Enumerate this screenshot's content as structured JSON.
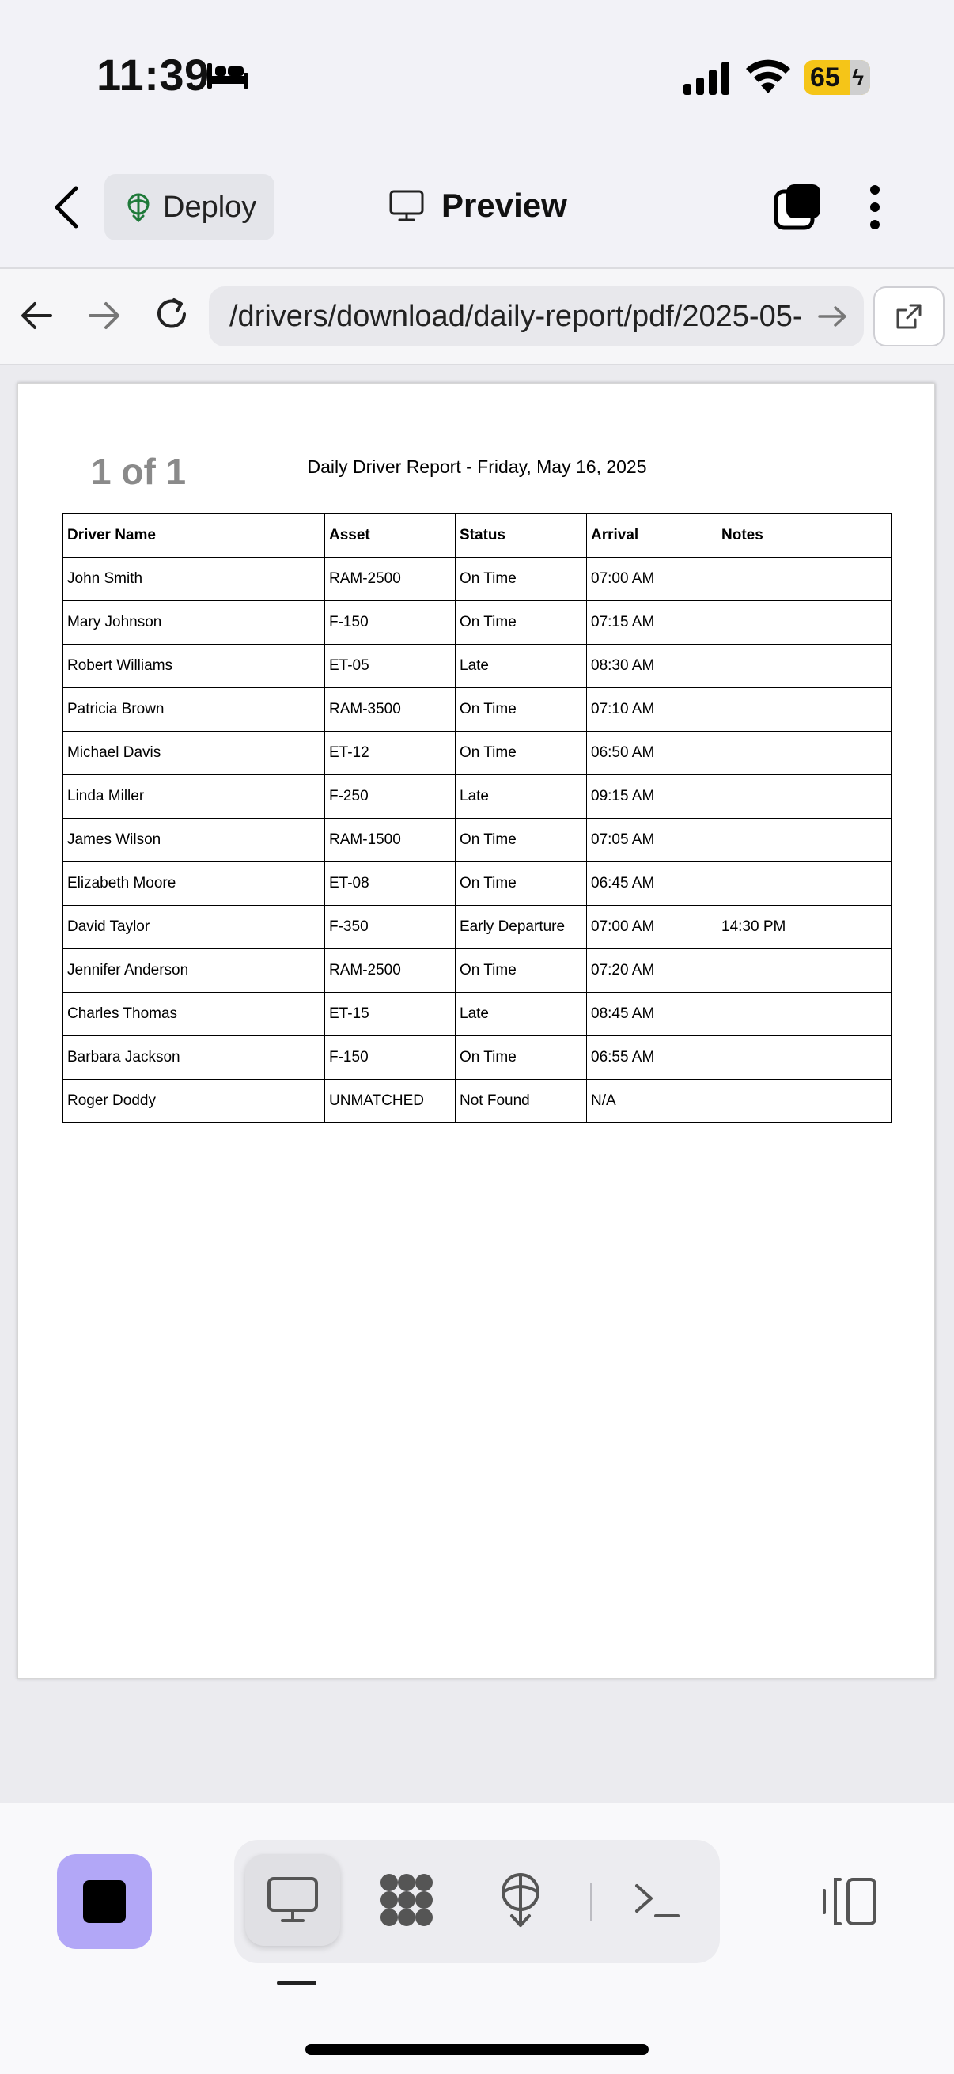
{
  "status_bar": {
    "time": "11:39",
    "battery": "65",
    "icons": [
      "bed-icon",
      "signal-icon",
      "wifi-icon",
      "battery-charging-icon"
    ]
  },
  "header": {
    "deploy_label": "Deploy",
    "title": "Preview"
  },
  "browser": {
    "url": "/drivers/download/daily-report/pdf/2025-05-"
  },
  "pdf": {
    "page_indicator": "1 of 1",
    "report_title": "Daily Driver Report - Friday, May 16, 2025",
    "columns": [
      "Driver Name",
      "Asset",
      "Status",
      "Arrival",
      "Notes"
    ],
    "rows": [
      [
        "John Smith",
        "RAM-2500",
        "On Time",
        "07:00 AM",
        ""
      ],
      [
        "Mary Johnson",
        "F-150",
        "On Time",
        "07:15 AM",
        ""
      ],
      [
        "Robert Williams",
        "ET-05",
        "Late",
        "08:30 AM",
        ""
      ],
      [
        "Patricia Brown",
        "RAM-3500",
        "On Time",
        "07:10 AM",
        ""
      ],
      [
        "Michael Davis",
        "ET-12",
        "On Time",
        "06:50 AM",
        ""
      ],
      [
        "Linda Miller",
        "F-250",
        "Late",
        "09:15 AM",
        ""
      ],
      [
        "James Wilson",
        "RAM-1500",
        "On Time",
        "07:05 AM",
        ""
      ],
      [
        "Elizabeth Moore",
        "ET-08",
        "On Time",
        "06:45 AM",
        ""
      ],
      [
        "David Taylor",
        "F-350",
        "Early Departure",
        "07:00 AM",
        "14:30 PM"
      ],
      [
        "Jennifer Anderson",
        "RAM-2500",
        "On Time",
        "07:20 AM",
        ""
      ],
      [
        "Charles Thomas",
        "ET-15",
        "Late",
        "08:45 AM",
        ""
      ],
      [
        "Barbara Jackson",
        "F-150",
        "On Time",
        "06:55 AM",
        ""
      ],
      [
        "Roger Doddy",
        "UNMATCHED",
        "Not Found",
        "N/A",
        ""
      ]
    ]
  },
  "toolbar": {
    "tools": [
      "monitor-icon",
      "workspace-icon",
      "deploy-icon",
      "terminal-icon"
    ],
    "active_tool": "monitor-icon"
  },
  "colors": {
    "stop_button": "#b2a7f7",
    "battery": "#f5c518",
    "deploy_icon": "#1f7a3a"
  }
}
